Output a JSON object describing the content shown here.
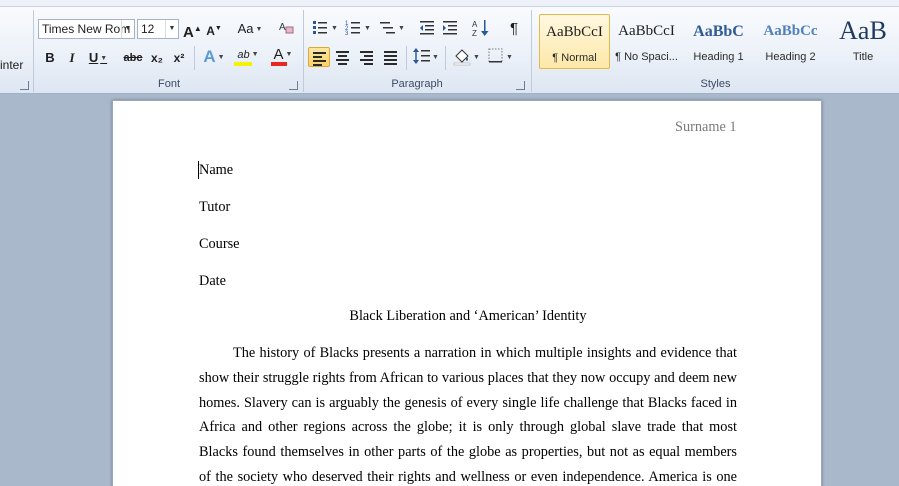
{
  "ribbon": {
    "clipboard": {
      "painter_label": "inter"
    },
    "font": {
      "group_label": "Font",
      "font_name": "Times New Rom",
      "font_size": "12",
      "grow_font": "A",
      "shrink_font": "A",
      "change_case": "Aa",
      "bold": "B",
      "italic": "I",
      "underline": "U",
      "strikethrough": "abc",
      "subscript": "x₂",
      "superscript": "x²",
      "text_effects": "A",
      "highlight": "ab",
      "font_color": "A",
      "highlight_color": "#f5f200",
      "font_color_value": "#e8281e"
    },
    "paragraph": {
      "group_label": "Paragraph",
      "pilcrow": "¶"
    },
    "styles": {
      "group_label": "Styles",
      "items": [
        {
          "sample": "AaBbCcI",
          "name": "¶ Normal",
          "selected": true
        },
        {
          "sample": "AaBbCcI",
          "name": "¶ No Spaci..."
        },
        {
          "sample": "AaBbC",
          "name": "Heading 1"
        },
        {
          "sample": "AaBbCc",
          "name": "Heading 2"
        },
        {
          "sample": "AaB",
          "name": "Title"
        }
      ]
    }
  },
  "document": {
    "header": "Surname 1",
    "lines": [
      "Name",
      "Tutor",
      "Course",
      "Date"
    ],
    "title": "Black Liberation and ‘American’ Identity",
    "paragraph": [
      "The history of Blacks presents a narration in which multiple insights and evidence that",
      "show their struggle rights from African to various places that they now occupy and deem new",
      "homes. Slavery can is arguably the genesis of every single life challenge that Blacks faced in",
      "Africa and other regions across the globe; it is only through global slave trade that most",
      "Blacks found themselves in other parts of the globe as properties, but not as equal members",
      "of the society who deserved their rights and wellness or even independence.  America is one"
    ]
  }
}
